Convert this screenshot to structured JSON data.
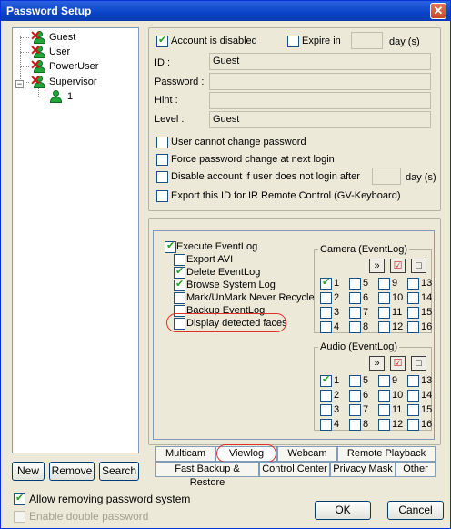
{
  "window": {
    "title": "Password Setup",
    "close_glyph": "✕"
  },
  "tree": {
    "items": [
      {
        "label": "Guest",
        "disabled": true
      },
      {
        "label": "User",
        "disabled": true
      },
      {
        "label": "PowerUser",
        "disabled": true
      },
      {
        "label": "Supervisor",
        "disabled": true,
        "expanded": true
      },
      {
        "label": "1",
        "disabled": false
      }
    ],
    "expander_glyph": "−"
  },
  "bottom_left_buttons": {
    "new": "New",
    "remove": "Remove",
    "search": "Search"
  },
  "account": {
    "disabled_label": "Account is disabled",
    "disabled_checked": true,
    "expire_label": "Expire in",
    "expire_checked": false,
    "expire_value": "",
    "expire_unit": "day (s)",
    "id_label": "ID :",
    "id_value": "Guest",
    "password_label": "Password :",
    "password_value": "",
    "hint_label": "Hint :",
    "hint_value": "",
    "level_label": "Level :",
    "level_value": "Guest"
  },
  "options": {
    "cannot_change": "User cannot change password",
    "force_change": "Force password change at next login",
    "disable_if": "Disable account if user does not login after",
    "disable_days": "",
    "disable_unit": "day (s)",
    "export_ir": "Export this ID for IR Remote Control (GV-Keyboard)"
  },
  "eventlog": {
    "items": [
      {
        "label": "Execute EventLog",
        "checked": true
      },
      {
        "label": "Export AVI",
        "checked": false
      },
      {
        "label": "Delete EventLog",
        "checked": true
      },
      {
        "label": "Browse System Log",
        "checked": true
      },
      {
        "label": "Mark/UnMark Never Recycle",
        "checked": false
      },
      {
        "label": "Backup EventLog",
        "checked": false
      },
      {
        "label": "Display detected faces",
        "checked": false
      }
    ]
  },
  "camera_group": {
    "title": "Camera (EventLog)",
    "toolbar": [
      "»",
      "☑",
      "□"
    ],
    "numbers": [
      "1",
      "5",
      "9",
      "13",
      "2",
      "6",
      "10",
      "14",
      "3",
      "7",
      "11",
      "15",
      "4",
      "8",
      "12",
      "16"
    ],
    "checked": [
      "1"
    ]
  },
  "audio_group": {
    "title": "Audio (EventLog)",
    "toolbar": [
      "»",
      "☑",
      "□"
    ],
    "numbers": [
      "1",
      "5",
      "9",
      "13",
      "2",
      "6",
      "10",
      "14",
      "3",
      "7",
      "11",
      "15",
      "4",
      "8",
      "12",
      "16"
    ],
    "checked": [
      "1"
    ]
  },
  "tabs": {
    "row1": [
      "Multicam",
      "Viewlog",
      "Webcam",
      "Remote Playback"
    ],
    "row2": [
      "Fast Backup & Restore",
      "Control Center",
      "Privacy Mask",
      "Other"
    ],
    "active": "Viewlog"
  },
  "footer": {
    "allow_removing": "Allow removing password system",
    "allow_removing_checked": true,
    "enable_double": "Enable double password",
    "enable_double_checked": false,
    "ok": "OK",
    "cancel": "Cancel"
  }
}
